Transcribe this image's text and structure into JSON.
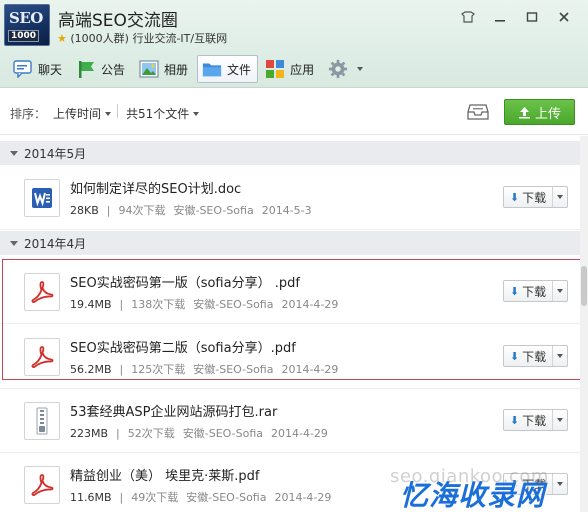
{
  "header": {
    "logo_text": "SEO",
    "logo_number": "1000",
    "group_name": "高端SEO交流圈",
    "group_info": "(1000人群) 行业交流-IT/互联网"
  },
  "toolbar": {
    "items": [
      {
        "label": "聊天",
        "icon": "chat-icon"
      },
      {
        "label": "公告",
        "icon": "announcement-icon"
      },
      {
        "label": "相册",
        "icon": "album-icon"
      },
      {
        "label": "文件",
        "icon": "folder-icon",
        "active": true
      },
      {
        "label": "应用",
        "icon": "apps-icon"
      }
    ]
  },
  "sortbar": {
    "label": "排序：",
    "value": "上传时间",
    "count": "共51个文件",
    "upload_label": "上传"
  },
  "sections": [
    {
      "title": "2014年5月"
    },
    {
      "title": "2014年4月"
    }
  ],
  "files": [
    {
      "name": "如何制定详尽的SEO计划.doc",
      "size": "28KB",
      "downloads": "94次下载",
      "uploader": "安徽-SEO-Sofia",
      "date": "2014-5-3",
      "type": "doc"
    },
    {
      "name": "SEO实战密码第一版（sofia分享） .pdf",
      "size": "19.4MB",
      "downloads": "138次下载",
      "uploader": "安徽-SEO-Sofia",
      "date": "2014-4-29",
      "type": "pdf"
    },
    {
      "name": "SEO实战密码第二版（sofia分享）.pdf",
      "size": "56.2MB",
      "downloads": "125次下载",
      "uploader": "安徽-SEO-Sofia",
      "date": "2014-4-29",
      "type": "pdf"
    },
    {
      "name": "53套经典ASP企业网站源码打包.rar",
      "size": "223MB",
      "downloads": "52次下载",
      "uploader": "安徽-SEO-Sofia",
      "date": "2014-4-29",
      "type": "rar"
    },
    {
      "name": "精益创业（美） 埃里克·莱斯.pdf",
      "size": "11.6MB",
      "downloads": "49次下载",
      "uploader": "安徽-SEO-Sofia",
      "date": "2014-4-29",
      "type": "pdf"
    }
  ],
  "download_label": "下载",
  "watermark": {
    "url": "seo.qiankoo.com",
    "brand": "忆海收录网"
  },
  "colors": {
    "upload_green": "#4aa82c",
    "pdf_red": "#d0312d",
    "word_blue": "#2b5fb3",
    "highlight_red": "#c8464f"
  }
}
